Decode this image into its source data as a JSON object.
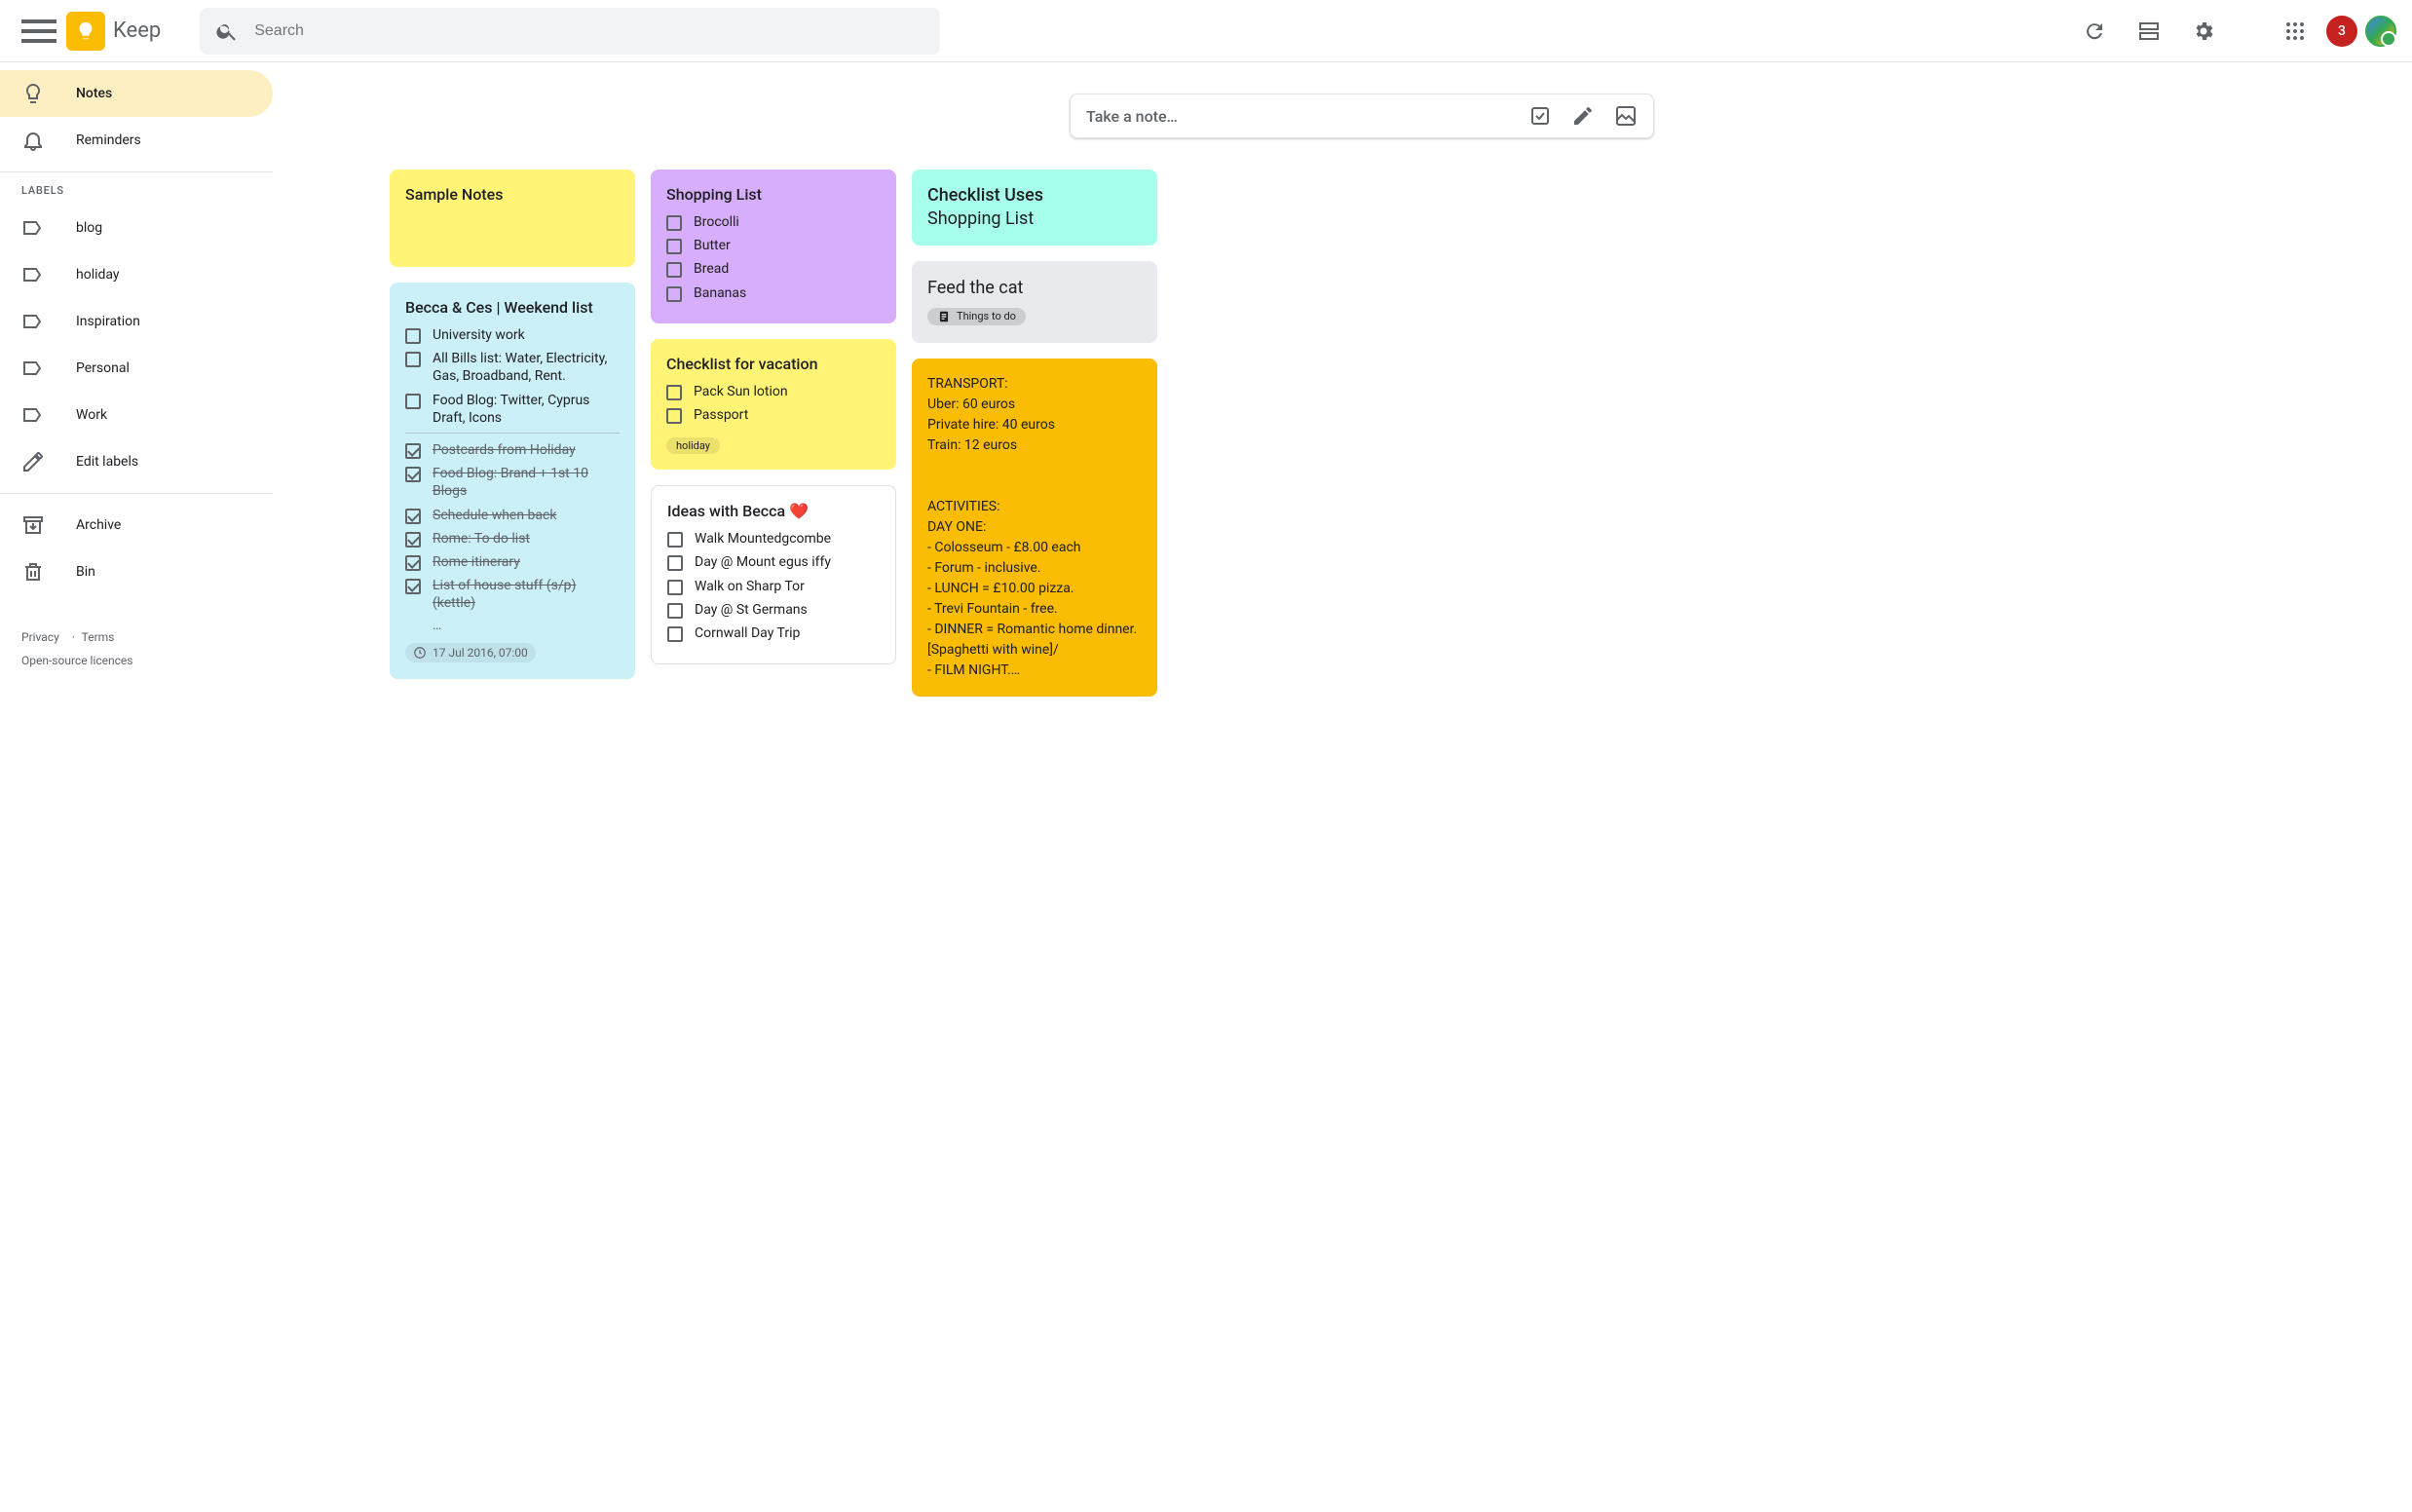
{
  "app": {
    "name": "Keep"
  },
  "search": {
    "placeholder": "Search"
  },
  "badge": "3",
  "sidebar": {
    "notes": "Notes",
    "reminders": "Reminders",
    "labels_heading": "LABELS",
    "labels": [
      "blog",
      "holiday",
      "Inspiration",
      "Personal",
      "Work"
    ],
    "edit_labels": "Edit labels",
    "archive": "Archive",
    "bin": "Bin"
  },
  "footer": {
    "privacy": "Privacy",
    "terms": "Terms",
    "licences": "Open-source licences"
  },
  "takenote": {
    "placeholder": "Take a note…"
  },
  "notes": {
    "sample": {
      "title": "Sample Notes"
    },
    "weekend": {
      "title": "Becca & Ces | Weekend list",
      "unchecked": [
        "University work",
        "All Bills list: Water, Electricity, Gas, Broadband, Rent.",
        "Food Blog: Twitter, Cyprus Draft, Icons"
      ],
      "checked": [
        "Postcards from Holiday",
        "Food Blog: Brand + 1st 10 Blogs",
        "Schedule when back",
        "Rome: To do list",
        "Rome itinerary",
        "List of house stuff (s/p) (kettle)"
      ],
      "more": "…",
      "reminder": "17 Jul 2016, 07:00"
    },
    "shopping": {
      "title": "Shopping List",
      "items": [
        "Brocolli",
        "Butter",
        "Bread",
        "Bananas"
      ]
    },
    "vacation": {
      "title": "Checklist for vacation",
      "items": [
        "Pack Sun lotion",
        "Passport"
      ],
      "label": "holiday"
    },
    "ideas": {
      "title": "Ideas with Becca ❤️",
      "items": [
        "Walk Mountedgcombe",
        "Day @ Mount egus iffy",
        "Walk on Sharp Tor",
        "Day @ St Germans",
        "Cornwall Day Trip"
      ]
    },
    "checklist_uses": {
      "title": "Checklist Uses",
      "body": "Shopping List"
    },
    "feedcat": {
      "title": "Feed the cat",
      "chip": "Things to do"
    },
    "transport": {
      "text": "TRANSPORT:\nUber: 60 euros\nPrivate hire: 40 euros\nTrain: 12 euros\n\n\nACTIVITIES:\nDAY ONE:\n- Colosseum - £8.00 each\n- Forum - inclusive.\n- LUNCH = £10.00 pizza.\n- Trevi Fountain - free.\n- DINNER = Romantic home dinner. [Spaghetti with wine]/\n- FILM NIGHT.…"
    }
  }
}
